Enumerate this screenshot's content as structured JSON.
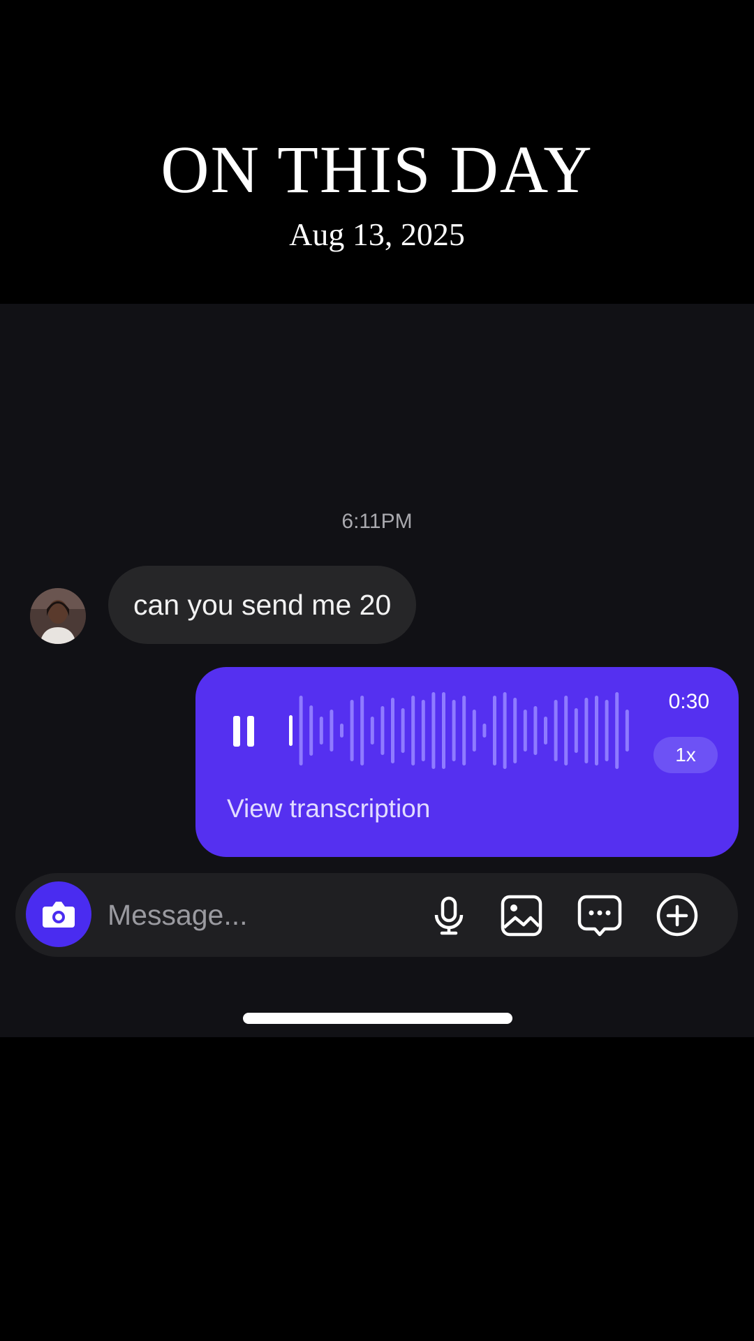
{
  "header": {
    "title": "ON THIS DAY",
    "date": "Aug 13, 2025"
  },
  "chat": {
    "timestamp": "6:11PM",
    "incoming_message": "can you send me 20",
    "voice_message": {
      "duration": "0:30",
      "speed": "1x",
      "transcription_link": "View transcription",
      "progress": 0.0,
      "state": "playing"
    }
  },
  "composer": {
    "placeholder": "Message..."
  },
  "colors": {
    "accent": "#5530f0",
    "background": "#111115",
    "incoming_bubble": "#262628"
  },
  "icons": {
    "camera": "camera-icon",
    "mic": "microphone-icon",
    "gallery": "image-icon",
    "sticker": "chat-bubble-icon",
    "add": "plus-circle-icon",
    "pause": "pause-icon"
  }
}
